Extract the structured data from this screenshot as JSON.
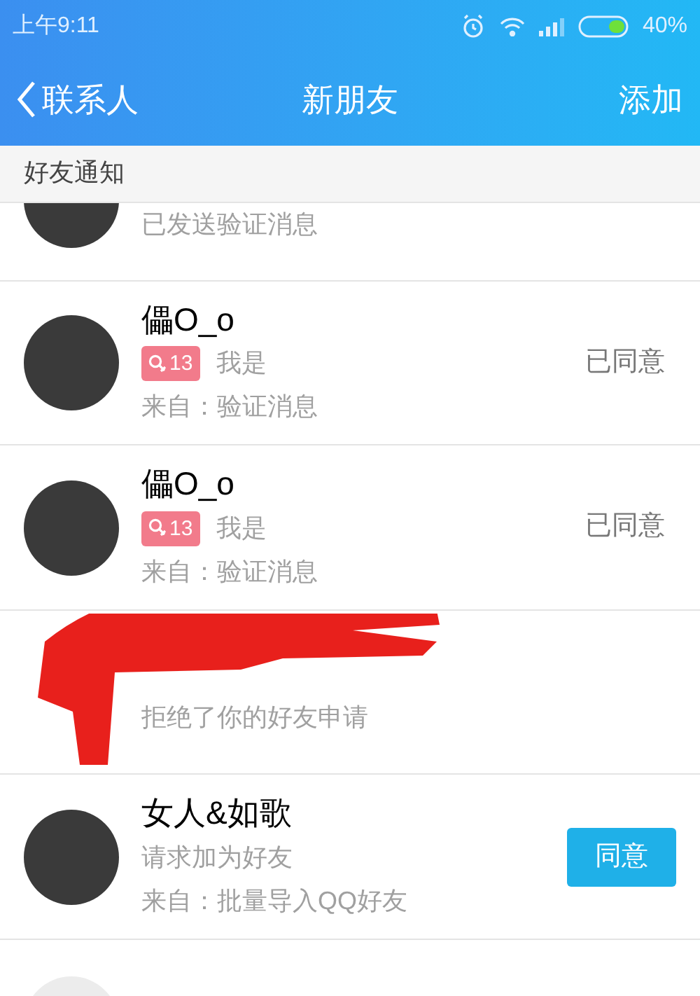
{
  "status_bar": {
    "time": "上午9:11",
    "battery": "40%"
  },
  "nav": {
    "back": "联系人",
    "title": "新朋友",
    "action": "添加"
  },
  "section": {
    "title": "好友通知"
  },
  "rows": [
    {
      "kind": "partial",
      "lines": [
        "已发送验证消息"
      ]
    },
    {
      "kind": "person",
      "name": "儡O_o",
      "badge": "13",
      "lines": [
        "我是",
        "来自：验证消息"
      ],
      "status": "已同意"
    },
    {
      "kind": "person",
      "name": "儡O_o",
      "badge": "13",
      "lines": [
        "我是",
        "来自：验证消息"
      ],
      "status": "已同意"
    },
    {
      "kind": "redacted",
      "lines": [
        "拒绝了你的好友申请"
      ]
    },
    {
      "kind": "person",
      "name": "女人&如歌",
      "lines": [
        "请求加为好友",
        "来自：批量导入QQ好友"
      ],
      "button": "同意"
    },
    {
      "kind": "cut"
    }
  ]
}
